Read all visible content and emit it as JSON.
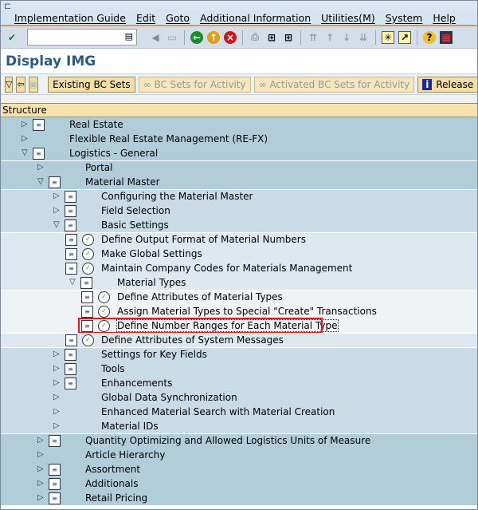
{
  "menu": [
    "Implementation Guide",
    "Edit",
    "Goto",
    "Additional Information",
    "Utilities(M)",
    "System",
    "Help"
  ],
  "toolbar": {
    "command_value": "",
    "icons": [
      "enter-icon",
      "back-arrow-icon",
      "save-icon",
      "back-icon",
      "exit-icon",
      "cancel-icon",
      "print-icon",
      "find-icon",
      "find-next-icon",
      "first-page-icon",
      "previous-page-icon",
      "next-page-icon",
      "last-page-icon",
      "create-session-icon",
      "shortcut-icon",
      "help-icon",
      "layout-icon"
    ]
  },
  "title": "Display IMG",
  "app_toolbar": {
    "existing_bc_sets": "Existing BC Sets",
    "bc_sets_activity": "BC Sets for Activity",
    "activated_bc_sets": "Activated BC Sets for Activity",
    "release_notes": "Release"
  },
  "structure_header": "Structure",
  "tree": [
    {
      "label": "Real Estate",
      "level": 0,
      "node": "collapsed",
      "doc": true
    },
    {
      "label": "Flexible Real Estate Management (RE-FX)",
      "level": 0,
      "node": "collapsed",
      "doc": false
    },
    {
      "label": "Logistics - General",
      "level": 0,
      "node": "expanded",
      "doc": true
    },
    {
      "label": "Portal",
      "level": 1,
      "node": "collapsed",
      "doc": false
    },
    {
      "label": "Material Master",
      "level": 1,
      "node": "expanded",
      "doc": true
    },
    {
      "label": "Configuring the Material Master",
      "level": 2,
      "node": "collapsed",
      "doc": true
    },
    {
      "label": "Field Selection",
      "level": 2,
      "node": "collapsed",
      "doc": true
    },
    {
      "label": "Basic Settings",
      "level": 2,
      "node": "expanded",
      "doc": true
    },
    {
      "label": "Define Output Format of Material Numbers",
      "level": 3,
      "node": "leaf",
      "doc": true
    },
    {
      "label": "Make Global Settings",
      "level": 3,
      "node": "leaf",
      "doc": true
    },
    {
      "label": "Maintain Company Codes for Materials Management",
      "level": 3,
      "node": "leaf",
      "doc": true
    },
    {
      "label": "Material Types",
      "level": 3,
      "node": "expanded",
      "doc": true
    },
    {
      "label": "Define Attributes of Material Types",
      "level": 4,
      "node": "leaf",
      "doc": true
    },
    {
      "label": "Assign Material Types to Special \"Create\" Transactions",
      "level": 4,
      "node": "leaf",
      "doc": true
    },
    {
      "label": "Define Number Ranges for Each Material Type",
      "level": 4,
      "node": "leaf",
      "doc": true,
      "selected": true
    },
    {
      "label": "Define Attributes of System Messages",
      "level": 3,
      "node": "leaf",
      "doc": true
    },
    {
      "label": "Settings for Key Fields",
      "level": 2,
      "node": "collapsed",
      "doc": true
    },
    {
      "label": "Tools",
      "level": 2,
      "node": "collapsed",
      "doc": true
    },
    {
      "label": "Enhancements",
      "level": 2,
      "node": "collapsed",
      "doc": true
    },
    {
      "label": "Global Data Synchronization",
      "level": 2,
      "node": "collapsed",
      "doc": false
    },
    {
      "label": "Enhanced Material Search with Material Creation",
      "level": 2,
      "node": "collapsed",
      "doc": false
    },
    {
      "label": "Material IDs",
      "level": 2,
      "node": "collapsed",
      "doc": false
    },
    {
      "label": "Quantity Optimizing and Allowed Logistics Units of Measure",
      "level": 1,
      "node": "collapsed",
      "doc": true
    },
    {
      "label": "Article Hierarchy",
      "level": 1,
      "node": "collapsed",
      "doc": false
    },
    {
      "label": "Assortment",
      "level": 1,
      "node": "collapsed",
      "doc": true
    },
    {
      "label": "Additionals",
      "level": 1,
      "node": "collapsed",
      "doc": true
    },
    {
      "label": "Retail Pricing",
      "level": 1,
      "node": "collapsed",
      "doc": true
    }
  ]
}
